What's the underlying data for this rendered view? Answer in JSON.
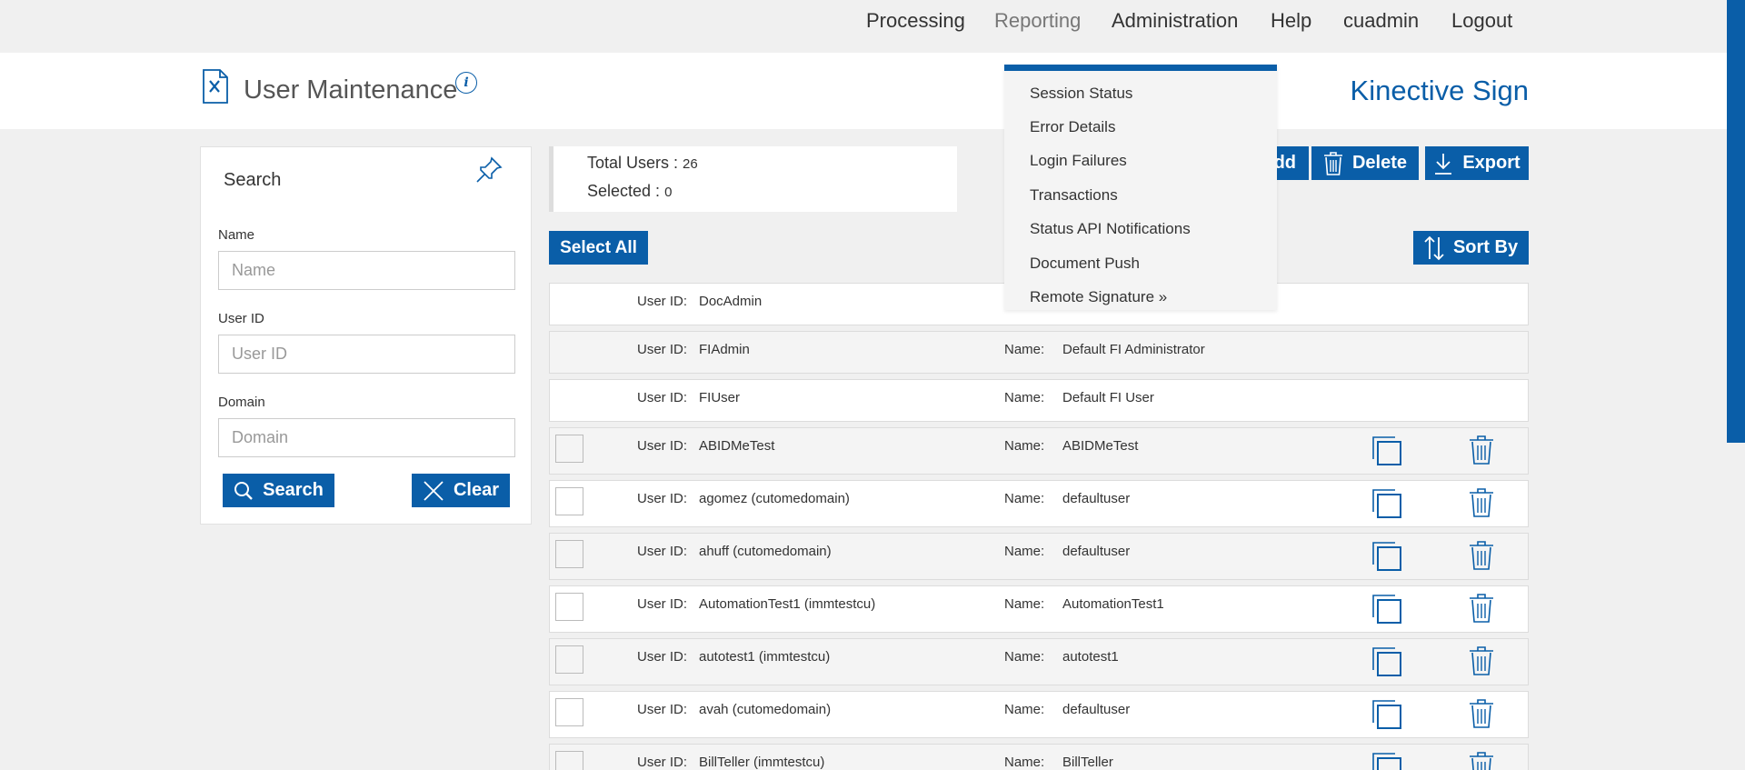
{
  "nav": {
    "items": [
      "Processing",
      "Reporting",
      "Administration",
      "Help",
      "cuadmin",
      "Logout"
    ]
  },
  "header": {
    "title": "User Maintenance",
    "info": "i",
    "brand": "Kinective Sign"
  },
  "search": {
    "title": "Search",
    "name_label": "Name",
    "name_placeholder": "Name",
    "userid_label": "User ID",
    "userid_placeholder": "User ID",
    "domain_label": "Domain",
    "domain_placeholder": "Domain",
    "search_button": "Search",
    "clear_button": "Clear"
  },
  "summary": {
    "total_label": "Total Users :",
    "total_value": "26",
    "selected_label": "Selected :",
    "selected_value": "0"
  },
  "toolbar": {
    "add_label": "dd",
    "delete_label": "Delete",
    "export_label": "Export",
    "select_all_label": "Select All",
    "sort_by_label": "Sort By"
  },
  "dropdown": {
    "items": [
      "Session Status",
      "Error Details",
      "Login Failures",
      "Transactions",
      "Status API Notifications",
      "Document Push",
      "Remote Signature »"
    ]
  },
  "users": {
    "userid_label": "User ID:",
    "name_label": "Name:",
    "rows": [
      {
        "user_id": "DocAdmin",
        "name": ""
      },
      {
        "user_id": "FIAdmin",
        "name": "Default FI Administrator"
      },
      {
        "user_id": "FIUser",
        "name": "Default FI User"
      },
      {
        "user_id": "ABIDMeTest",
        "name": "ABIDMeTest"
      },
      {
        "user_id": "agomez (cutomedomain)",
        "name": "defaultuser"
      },
      {
        "user_id": "ahuff (cutomedomain)",
        "name": "defaultuser"
      },
      {
        "user_id": "AutomationTest1 (immtestcu)",
        "name": "AutomationTest1"
      },
      {
        "user_id": "autotest1 (immtestcu)",
        "name": "autotest1"
      },
      {
        "user_id": "avah (cutomedomain)",
        "name": "defaultuser"
      },
      {
        "user_id": "BillTeller (immtestcu)",
        "name": "BillTeller"
      }
    ]
  },
  "colors": {
    "accent": "#0a5ea8",
    "background": "#f0f0f0"
  }
}
